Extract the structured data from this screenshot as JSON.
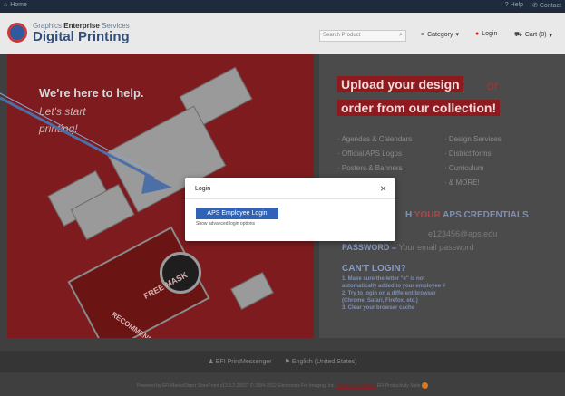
{
  "topbar": {
    "home": "Home",
    "help": "Help",
    "contact": "Contact"
  },
  "header": {
    "logo_line1_pre": "Graphics",
    "logo_line1_bold": "Enterprise",
    "logo_line1_post": "Services",
    "logo_line2": "Digital Printing",
    "search_placeholder": "Search Product",
    "category": "Category",
    "login": "Login",
    "cart": "Cart (0)"
  },
  "hero": {
    "headline": "We're here to help.",
    "sub1": "Let's start",
    "sub2": "printing!",
    "stamp_free_mask": "FREE MASK",
    "stamp_recommended": "RECOMMENDED"
  },
  "promo": {
    "line1": "Upload your design",
    "or": "or",
    "line2": "order from our collection!",
    "list_left": [
      "· Agendas & Calendars",
      "· Official APS Logos",
      "· Posters & Banners"
    ],
    "list_right": [
      "· Design Services",
      "· District forms",
      "· Curriculum",
      "· & MORE!"
    ],
    "cred_pre": "H",
    "cred_hl": "YOUR",
    "cred_post": "APS CREDENTIALS",
    "login_line": "e123456@aps.edu",
    "password_label": "PASSWORD =",
    "password_value": "Your email password",
    "cant_login": "CAN'T LOGIN?",
    "steps": [
      "1. Make sure the letter \"e\" is not",
      "    automatically added to your employee #",
      "2. Try to login on a different browser",
      "    (Chrome, Safari, Firefox, etc.)",
      "3. Clear your browser cache"
    ]
  },
  "footer": {
    "messenger": "EFI PrintMessenger",
    "language": "English (United States)",
    "powered": "Powered by EFI MarketDirect StoreFront v12.3.2.25927 © 2004-2022 Electronics For Imaging, Inc.",
    "terms": "Terms & Conditions",
    "suite": "EFI Productivity Suite"
  },
  "modal": {
    "title": "Login",
    "close": "×",
    "employee_login": "APS Employee Login",
    "advanced": "Show advanced login options"
  },
  "colors": {
    "accent_red": "#8c1a1e",
    "button_blue": "#2f63b8",
    "overlay_arrow": "#4d6fa8"
  }
}
